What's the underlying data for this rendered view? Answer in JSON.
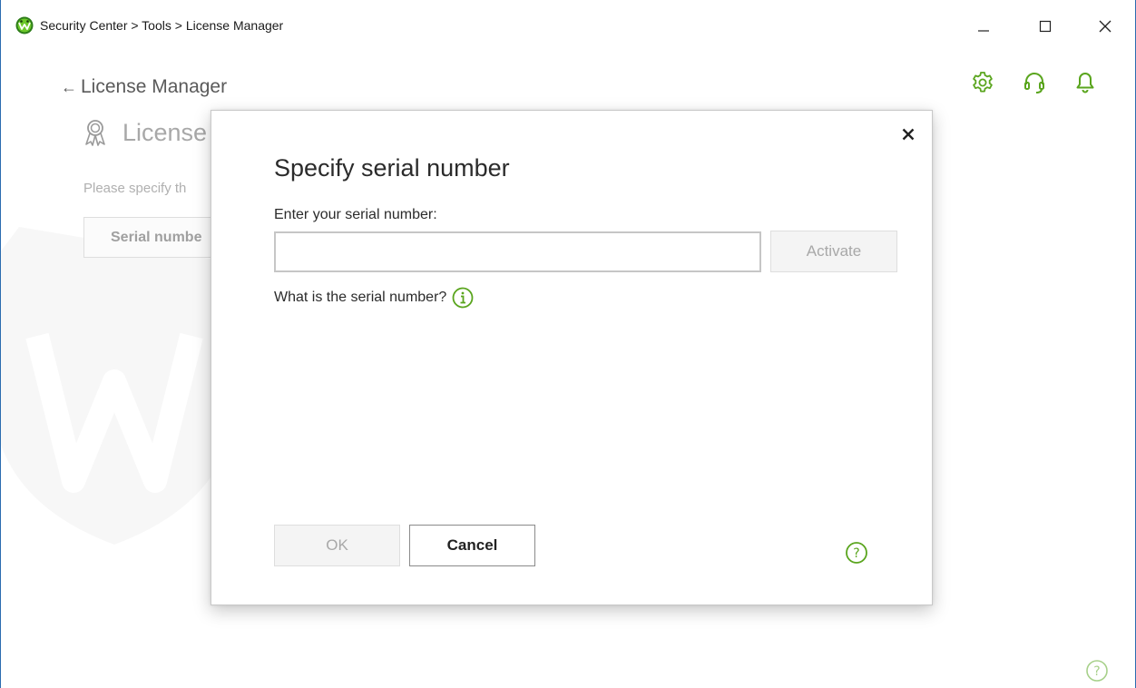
{
  "titlebar": {
    "title": "Security Center > Tools > License Manager",
    "controls": {
      "minimize_icon": "minimize-icon",
      "maximize_icon": "maximize-icon",
      "close_icon": "close-icon"
    }
  },
  "toolbar": {
    "icons": [
      "gear-icon",
      "support-headset-icon",
      "bell-icon"
    ]
  },
  "page": {
    "back_label": "License Manager",
    "section_title": "License",
    "description": "Please specify th",
    "serial_button_label": "Serial numbe"
  },
  "dialog": {
    "title": "Specify serial number",
    "field_label": "Enter your serial number:",
    "serial_value": "",
    "serial_placeholder": "",
    "activate_label": "Activate",
    "what_is_label": "What is the serial number?",
    "ok_label": "OK",
    "cancel_label": "Cancel"
  },
  "colors": {
    "accent_green": "#5aa51e",
    "window_border": "#2b6cb0",
    "disabled_text": "#a8a8a8",
    "watermark": "#f7f7f7"
  }
}
